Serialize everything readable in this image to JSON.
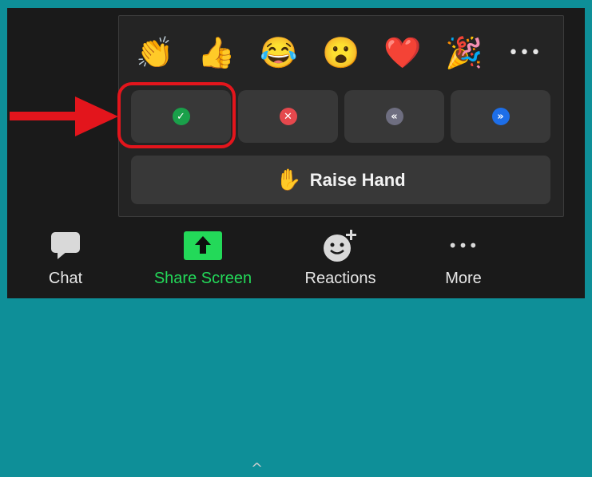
{
  "reactions": [
    {
      "name": "clapping-hands-icon",
      "glyph": "👏"
    },
    {
      "name": "thumbs-up-icon",
      "glyph": "👍"
    },
    {
      "name": "tears-of-joy-icon",
      "glyph": "😂"
    },
    {
      "name": "surprised-face-icon",
      "glyph": "😮"
    },
    {
      "name": "red-heart-icon",
      "glyph": "❤️"
    },
    {
      "name": "party-popper-icon",
      "glyph": "🎉"
    }
  ],
  "more_reactions": "•••",
  "status_buttons": [
    {
      "name": "yes-button",
      "icon": "check-icon",
      "glyph": "✓",
      "color": "#1aa04a"
    },
    {
      "name": "no-button",
      "icon": "x-icon",
      "glyph": "✕",
      "color": "#e5484d"
    },
    {
      "name": "go-slower-button",
      "icon": "rewind-icon",
      "glyph": "«",
      "color": "#6e6e80"
    },
    {
      "name": "go-faster-button",
      "icon": "fast-forward-icon",
      "glyph": "»",
      "color": "#1d6ee8"
    }
  ],
  "raise_hand": {
    "glyph": "✋",
    "label": "Raise Hand"
  },
  "toolbar": {
    "chat": {
      "label": "Chat",
      "icon": "chat-bubble-icon"
    },
    "share_screen": {
      "label": "Share Screen",
      "icon": "share-screen-icon",
      "caret": "^",
      "color": "#23d959"
    },
    "reactions": {
      "label": "Reactions",
      "icon": "add-reaction-icon"
    },
    "more": {
      "label": "More",
      "icon": "more-dots-icon",
      "glyph": "•••"
    }
  },
  "annotation_colors": {
    "highlight": "#e3151c",
    "background": "#0e8f98"
  }
}
